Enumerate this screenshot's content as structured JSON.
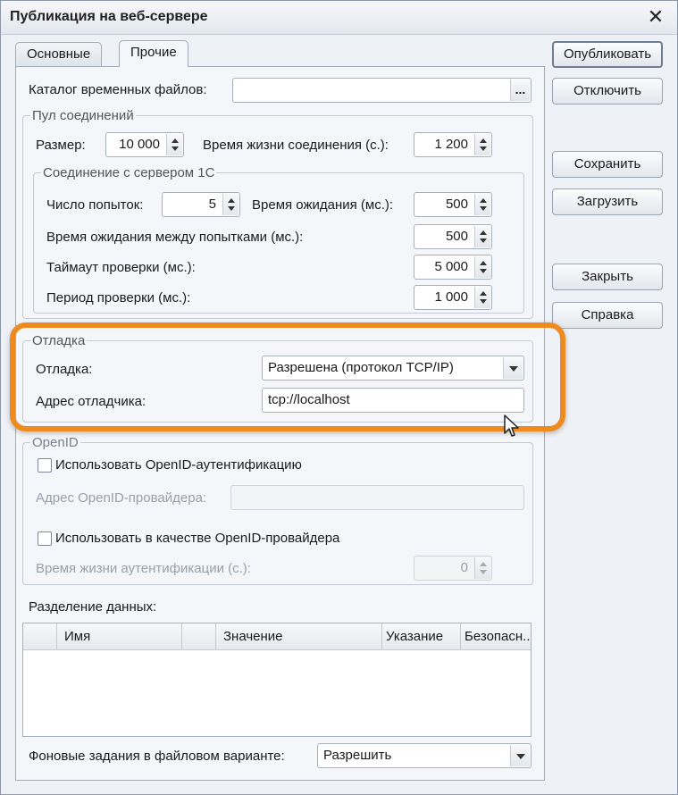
{
  "window": {
    "title": "Публикация на веб-сервере",
    "close_glyph": "✕"
  },
  "tabs": [
    {
      "label": "Основные",
      "active": false
    },
    {
      "label": "Прочие",
      "active": true
    }
  ],
  "temp_catalog": {
    "label": "Каталог временных файлов:",
    "value": "",
    "button": "..."
  },
  "pool": {
    "legend": "Пул соединений",
    "size_label": "Размер:",
    "size_value": "10 000",
    "lifetime_label": "Время жизни соединения (с.):",
    "lifetime_value": "1 200",
    "server": {
      "legend": "Соединение с сервером 1С",
      "attempts_label": "Число попыток:",
      "attempts_value": "5",
      "wait_label": "Время ожидания (мс.):",
      "wait_value": "500",
      "between_label": "Время ожидания между попытками (мс.):",
      "between_value": "500",
      "check_timeout_label": "Таймаут проверки (мс.):",
      "check_timeout_value": "5 000",
      "check_period_label": "Период проверки (мс.):",
      "check_period_value": "1 000"
    }
  },
  "debug": {
    "legend": "Отладка",
    "mode_label": "Отладка:",
    "mode_value": "Разрешена (протокол TCP/IP)",
    "address_label": "Адрес отладчика:",
    "address_value": "tcp://localhost"
  },
  "openid": {
    "legend": "OpenID",
    "use_auth_label": "Использовать OpenID-аутентификацию",
    "use_auth_checked": false,
    "provider_address_label": "Адрес OpenID-провайдера:",
    "provider_address_value": "",
    "as_provider_label": "Использовать в качестве OpenID-провайдера",
    "as_provider_checked": false,
    "auth_lifetime_label": "Время жизни аутентификации (с.):",
    "auth_lifetime_value": "0"
  },
  "data_separation": {
    "label": "Разделение данных:",
    "columns": [
      "",
      "Имя",
      "",
      "Значение",
      "Указание",
      "Безопасн..."
    ],
    "rows": []
  },
  "background_jobs": {
    "label": "Фоновые задания в файловом варианте:",
    "value": "Разрешить"
  },
  "buttons": {
    "publish": "Опубликовать",
    "disable": "Отключить",
    "save": "Сохранить",
    "load": "Загрузить",
    "close": "Закрыть",
    "help": "Справка"
  },
  "colors": {
    "highlight": "#ef8a1f",
    "window_bg": "#eef1f6"
  }
}
